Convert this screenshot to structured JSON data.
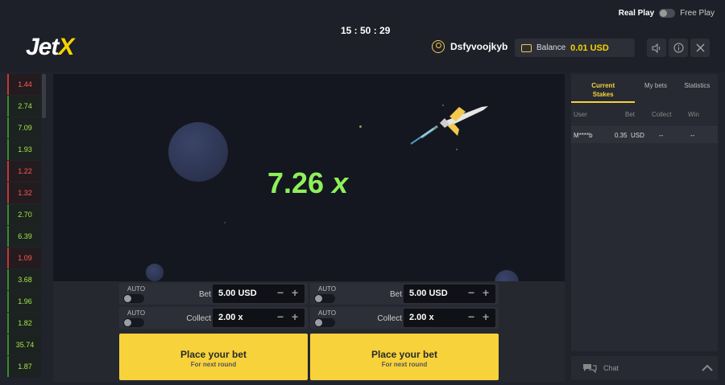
{
  "header": {
    "logo_main": "Jet",
    "logo_x": "X",
    "clock": "15 : 50 : 29",
    "real_play": "Real Play",
    "free_play": "Free Play",
    "username": "Dsfyvoojkyb",
    "balance_label": "Balance",
    "balance_value": "0.01 USD",
    "sound_icon": "speaker-icon",
    "info_icon": "info-icon",
    "close_icon": "close-icon"
  },
  "history": [
    {
      "v": "1.44",
      "s": "red"
    },
    {
      "v": "2.74",
      "s": "green"
    },
    {
      "v": "7.09",
      "s": "green"
    },
    {
      "v": "1.93",
      "s": "green"
    },
    {
      "v": "1.22",
      "s": "red"
    },
    {
      "v": "1.32",
      "s": "red"
    },
    {
      "v": "2.70",
      "s": "green"
    },
    {
      "v": "6.39",
      "s": "green"
    },
    {
      "v": "1.09",
      "s": "red"
    },
    {
      "v": "3.68",
      "s": "green"
    },
    {
      "v": "1.96",
      "s": "green"
    },
    {
      "v": "1.82",
      "s": "green"
    },
    {
      "v": "35.74",
      "s": "green"
    },
    {
      "v": "1.87",
      "s": "green"
    }
  ],
  "game": {
    "multiplier": "7.26",
    "multiplier_suffix": "x"
  },
  "bets": [
    {
      "auto1": "AUTO",
      "bet_label": "Bet",
      "bet_value": "5.00 USD",
      "auto2": "AUTO",
      "collect_label": "Collect",
      "collect_value": "2.00 x",
      "button_main": "Place your bet",
      "button_sub": "For next round"
    },
    {
      "auto1": "AUTO",
      "bet_label": "Bet",
      "bet_value": "5.00 USD",
      "auto2": "AUTO",
      "collect_label": "Collect",
      "collect_value": "2.00 x",
      "button_main": "Place your bet",
      "button_sub": "For next round"
    }
  ],
  "side": {
    "tabs": [
      "Current Stakes",
      "My bets",
      "Statistics"
    ],
    "columns": [
      "User",
      "Bet",
      "Collect",
      "Win"
    ],
    "rows": [
      {
        "user": "M****b",
        "bet": "0.35",
        "currency": "USD",
        "collect": "--",
        "win": "--"
      }
    ],
    "chat_label": "Chat"
  },
  "colors": {
    "accent": "#f7d23b",
    "win_green": "#8ef05a",
    "loss_red": "#ff5a5a"
  }
}
